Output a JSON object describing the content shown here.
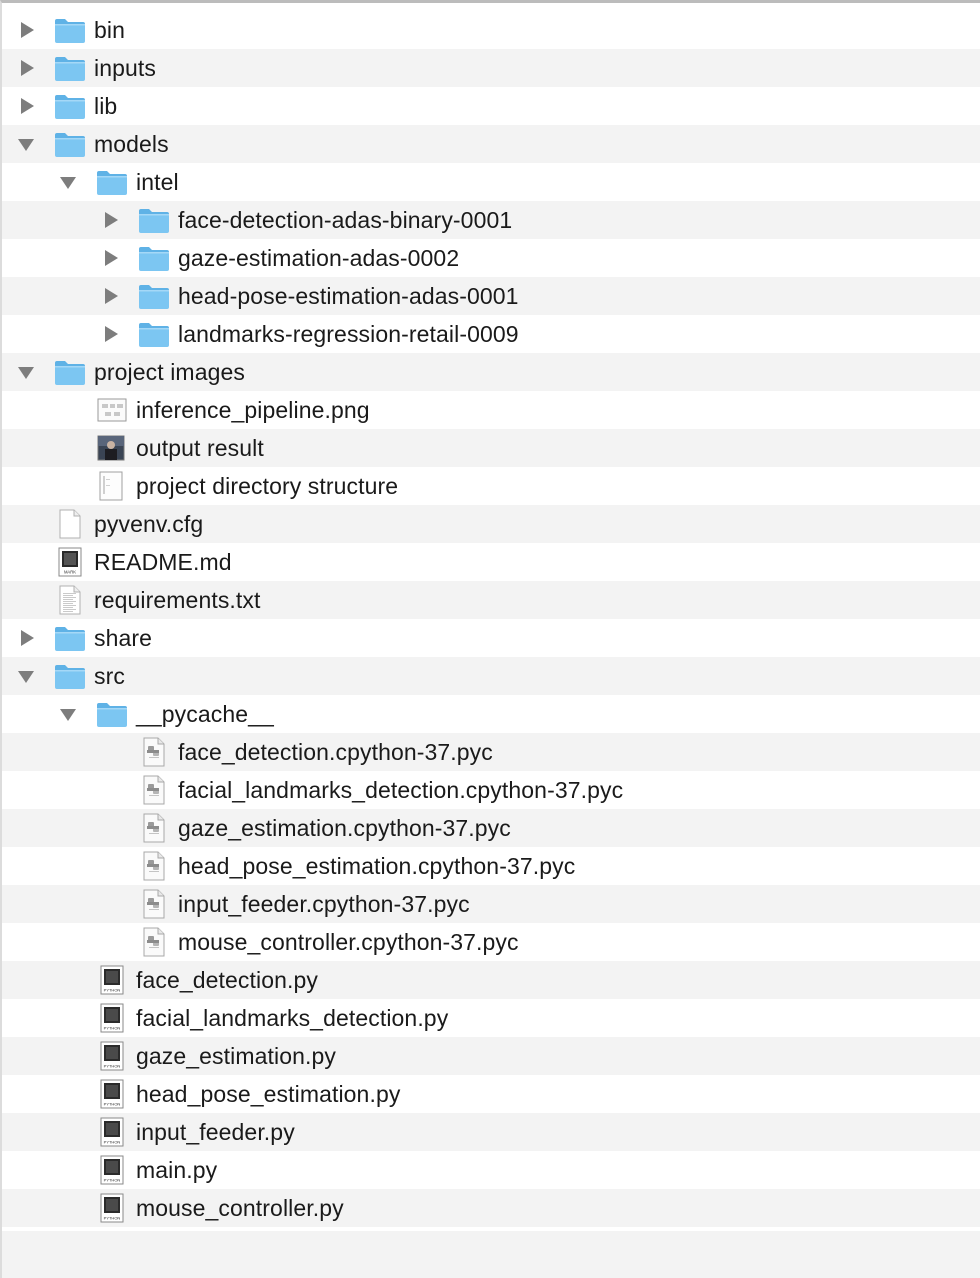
{
  "tree": [
    {
      "label": "bin",
      "depth": 0,
      "type": "folder",
      "expand": "collapsed",
      "icon": "folder-icon"
    },
    {
      "label": "inputs",
      "depth": 0,
      "type": "folder",
      "expand": "collapsed",
      "icon": "folder-icon"
    },
    {
      "label": "lib",
      "depth": 0,
      "type": "folder",
      "expand": "collapsed",
      "icon": "folder-icon"
    },
    {
      "label": "models",
      "depth": 0,
      "type": "folder",
      "expand": "expanded",
      "icon": "folder-icon"
    },
    {
      "label": "intel",
      "depth": 1,
      "type": "folder",
      "expand": "expanded",
      "icon": "folder-icon"
    },
    {
      "label": "face-detection-adas-binary-0001",
      "depth": 2,
      "type": "folder",
      "expand": "collapsed",
      "icon": "folder-icon"
    },
    {
      "label": "gaze-estimation-adas-0002",
      "depth": 2,
      "type": "folder",
      "expand": "collapsed",
      "icon": "folder-icon"
    },
    {
      "label": "head-pose-estimation-adas-0001",
      "depth": 2,
      "type": "folder",
      "expand": "collapsed",
      "icon": "folder-icon"
    },
    {
      "label": "landmarks-regression-retail-0009",
      "depth": 2,
      "type": "folder",
      "expand": "collapsed",
      "icon": "folder-icon"
    },
    {
      "label": "project images",
      "depth": 0,
      "type": "folder",
      "expand": "expanded",
      "icon": "folder-icon"
    },
    {
      "label": " inference_pipeline.png",
      "depth": 1,
      "type": "image-diagram",
      "expand": "none",
      "icon": "image-file-icon"
    },
    {
      "label": "output result",
      "depth": 1,
      "type": "image-photo",
      "expand": "none",
      "icon": "photo-file-icon"
    },
    {
      "label": "project directory structure",
      "depth": 1,
      "type": "image-doc",
      "expand": "none",
      "icon": "screenshot-file-icon"
    },
    {
      "label": "pyvenv.cfg",
      "depth": 0,
      "type": "blank",
      "expand": "none",
      "icon": "blank-file-icon"
    },
    {
      "label": "README.md",
      "depth": 0,
      "type": "markdown",
      "expand": "none",
      "icon": "markdown-file-icon"
    },
    {
      "label": "requirements.txt",
      "depth": 0,
      "type": "text",
      "expand": "none",
      "icon": "text-file-icon"
    },
    {
      "label": "share",
      "depth": 0,
      "type": "folder",
      "expand": "collapsed",
      "icon": "folder-icon"
    },
    {
      "label": "src",
      "depth": 0,
      "type": "folder",
      "expand": "expanded",
      "icon": "folder-icon"
    },
    {
      "label": "__pycache__",
      "depth": 1,
      "type": "folder",
      "expand": "expanded",
      "icon": "folder-icon"
    },
    {
      "label": "face_detection.cpython-37.pyc",
      "depth": 2,
      "type": "pyc",
      "expand": "none",
      "icon": "compiled-python-file-icon"
    },
    {
      "label": "facial_landmarks_detection.cpython-37.pyc",
      "depth": 2,
      "type": "pyc",
      "expand": "none",
      "icon": "compiled-python-file-icon"
    },
    {
      "label": "gaze_estimation.cpython-37.pyc",
      "depth": 2,
      "type": "pyc",
      "expand": "none",
      "icon": "compiled-python-file-icon"
    },
    {
      "label": "head_pose_estimation.cpython-37.pyc",
      "depth": 2,
      "type": "pyc",
      "expand": "none",
      "icon": "compiled-python-file-icon"
    },
    {
      "label": "input_feeder.cpython-37.pyc",
      "depth": 2,
      "type": "pyc",
      "expand": "none",
      "icon": "compiled-python-file-icon"
    },
    {
      "label": "mouse_controller.cpython-37.pyc",
      "depth": 2,
      "type": "pyc",
      "expand": "none",
      "icon": "compiled-python-file-icon"
    },
    {
      "label": "face_detection.py",
      "depth": 1,
      "type": "python",
      "expand": "none",
      "icon": "python-file-icon"
    },
    {
      "label": "facial_landmarks_detection.py",
      "depth": 1,
      "type": "python",
      "expand": "none",
      "icon": "python-file-icon"
    },
    {
      "label": "gaze_estimation.py",
      "depth": 1,
      "type": "python",
      "expand": "none",
      "icon": "python-file-icon"
    },
    {
      "label": "head_pose_estimation.py",
      "depth": 1,
      "type": "python",
      "expand": "none",
      "icon": "python-file-icon"
    },
    {
      "label": "input_feeder.py",
      "depth": 1,
      "type": "python",
      "expand": "none",
      "icon": "python-file-icon"
    },
    {
      "label": "main.py",
      "depth": 1,
      "type": "python",
      "expand": "none",
      "icon": "python-file-icon"
    },
    {
      "label": "mouse_controller.py",
      "depth": 1,
      "type": "python",
      "expand": "none",
      "icon": "python-file-icon"
    }
  ],
  "icon_text": {
    "markdown": "MARK",
    "python": "PYTHON"
  },
  "colors": {
    "folder_body": "#7cc6f2",
    "folder_tab": "#5fb2e6",
    "row_alt": "#f3f3f3",
    "disclosure": "#7d7d7d",
    "text": "#1a1a1a"
  }
}
